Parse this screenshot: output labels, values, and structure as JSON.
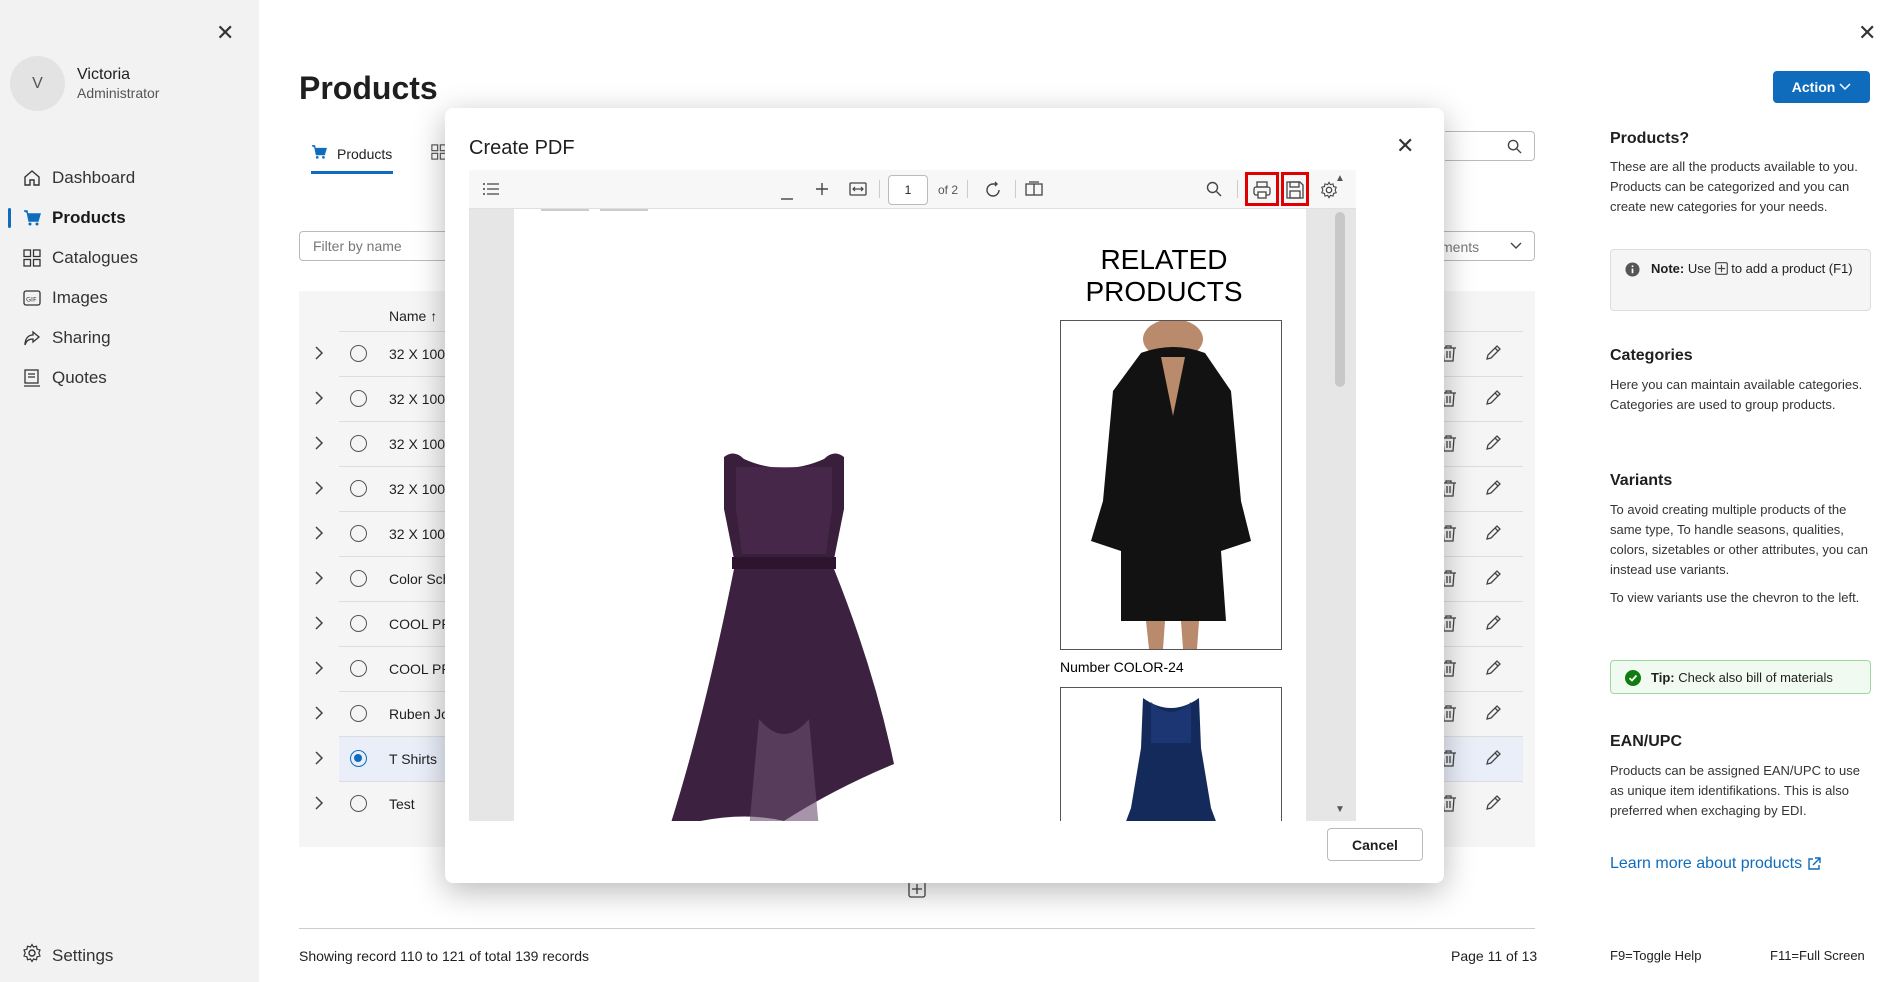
{
  "sidebar": {
    "user": {
      "initial": "V",
      "name": "Victoria",
      "role": "Administrator"
    },
    "items": [
      {
        "label": "Dashboard",
        "icon": "home-icon"
      },
      {
        "label": "Products",
        "icon": "cart-icon",
        "active": true
      },
      {
        "label": "Catalogues",
        "icon": "grid-icon"
      },
      {
        "label": "Images",
        "icon": "gif-icon"
      },
      {
        "label": "Sharing",
        "icon": "share-icon"
      },
      {
        "label": "Quotes",
        "icon": "quotes-icon"
      }
    ],
    "settings_label": "Settings"
  },
  "main": {
    "title": "Products",
    "tab_products": "Products",
    "filter_placeholder": "Filter by name",
    "dropdown_partial": "ments",
    "column_name": "Name ↑",
    "rows": [
      "32 X 100",
      "32 X 100",
      "32 X 100",
      "32 X 100",
      "32 X 100",
      "Color Sch",
      "COOL PR",
      "COOL PR",
      "Ruben Jo",
      "T Shirts",
      "Test"
    ],
    "selected_row": "T Shirts",
    "footer_records": "Showing record 110 to 121 of total 139 records",
    "footer_page": "Page 11 of 13"
  },
  "help": {
    "action_label": "Action",
    "products_title": "Products?",
    "products_text": "These are all the products available to you. Products can be categorized and you can create new categories for your needs.",
    "note_prefix": "Note:",
    "note_text_a": "Use",
    "note_text_b": "to add a product (F1)",
    "categories_title": "Categories",
    "categories_text": "Here you can maintain available categories. Categories are used to group products.",
    "variants_title": "Variants",
    "variants_text": "To avoid creating multiple products of the same type, To handle seasons, qualities, colors, sizetables or other attributes, you can instead use variants.",
    "variants_text2": "To view variants use the chevron to the left.",
    "tip_prefix": "Tip:",
    "tip_text": "Check also bill of materials",
    "ean_title": "EAN/UPC",
    "ean_text": "Products can be assigned EAN/UPC to use as unique item identifikations. This is also preferred when exchaging by EDI.",
    "learn_more": "Learn more about products",
    "f9": "F9=Toggle Help",
    "f11": "F11=Full Screen"
  },
  "modal": {
    "title": "Create PDF",
    "page_input": "1",
    "page_of": "of 2",
    "related_title": "RELATED PRODUCTS",
    "caption1": "Number COLOR-24",
    "cancel_label": "Cancel",
    "highlight_color": "#e00000"
  }
}
